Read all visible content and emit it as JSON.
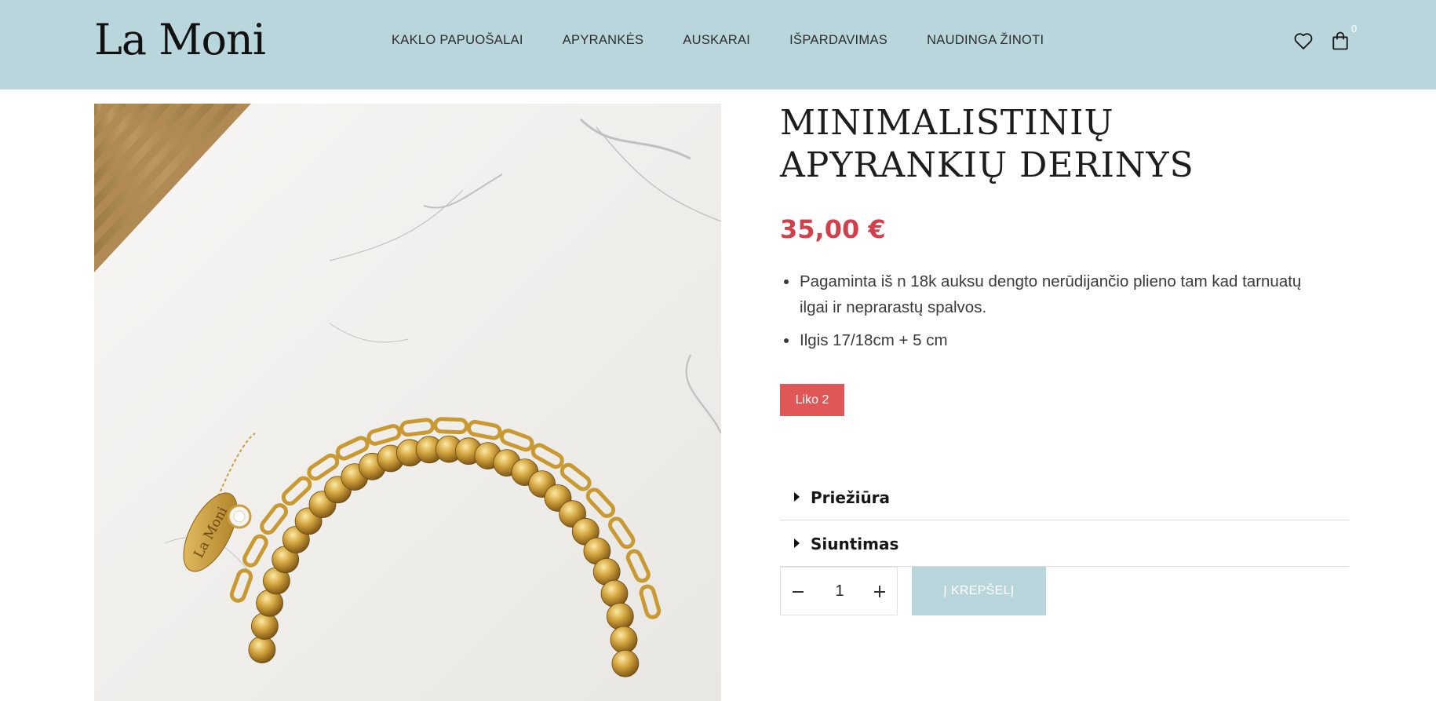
{
  "brand": {
    "logo_text": "La Moni",
    "header_bg": "#bad6dd"
  },
  "nav": {
    "items": [
      {
        "label": "KAKLO PAPUOŠALAI"
      },
      {
        "label": "APYRANKĖS"
      },
      {
        "label": "AUSKARAI"
      },
      {
        "label": "IŠPARDAVIMAS"
      },
      {
        "label": "NAUDINGA ŽINOTI"
      }
    ]
  },
  "header_icons": {
    "wishlist": "heart-icon",
    "cart": "shopping-bag-icon",
    "cart_count": "0"
  },
  "product": {
    "title": "MINIMALISTINIŲ APYRANKIŲ DERINYS",
    "price": "35,00 €",
    "price_color": "#d2404c",
    "features": [
      "Pagaminta iš n 18k auksu dengto nerūdijančio plieno tam kad tarnuatų ilgai ir neprarastų spalvos.",
      "Ilgis 17/18cm + 5 cm"
    ],
    "stock_badge": "Liko 2",
    "stock_badge_color": "#e05757",
    "image_tag_text": "La Moni"
  },
  "accordions": [
    {
      "label": "Priežiūra"
    },
    {
      "label": "Siuntimas"
    }
  ],
  "purchase": {
    "quantity": "1",
    "add_to_cart_label": "Į KREPŠELĮ"
  }
}
